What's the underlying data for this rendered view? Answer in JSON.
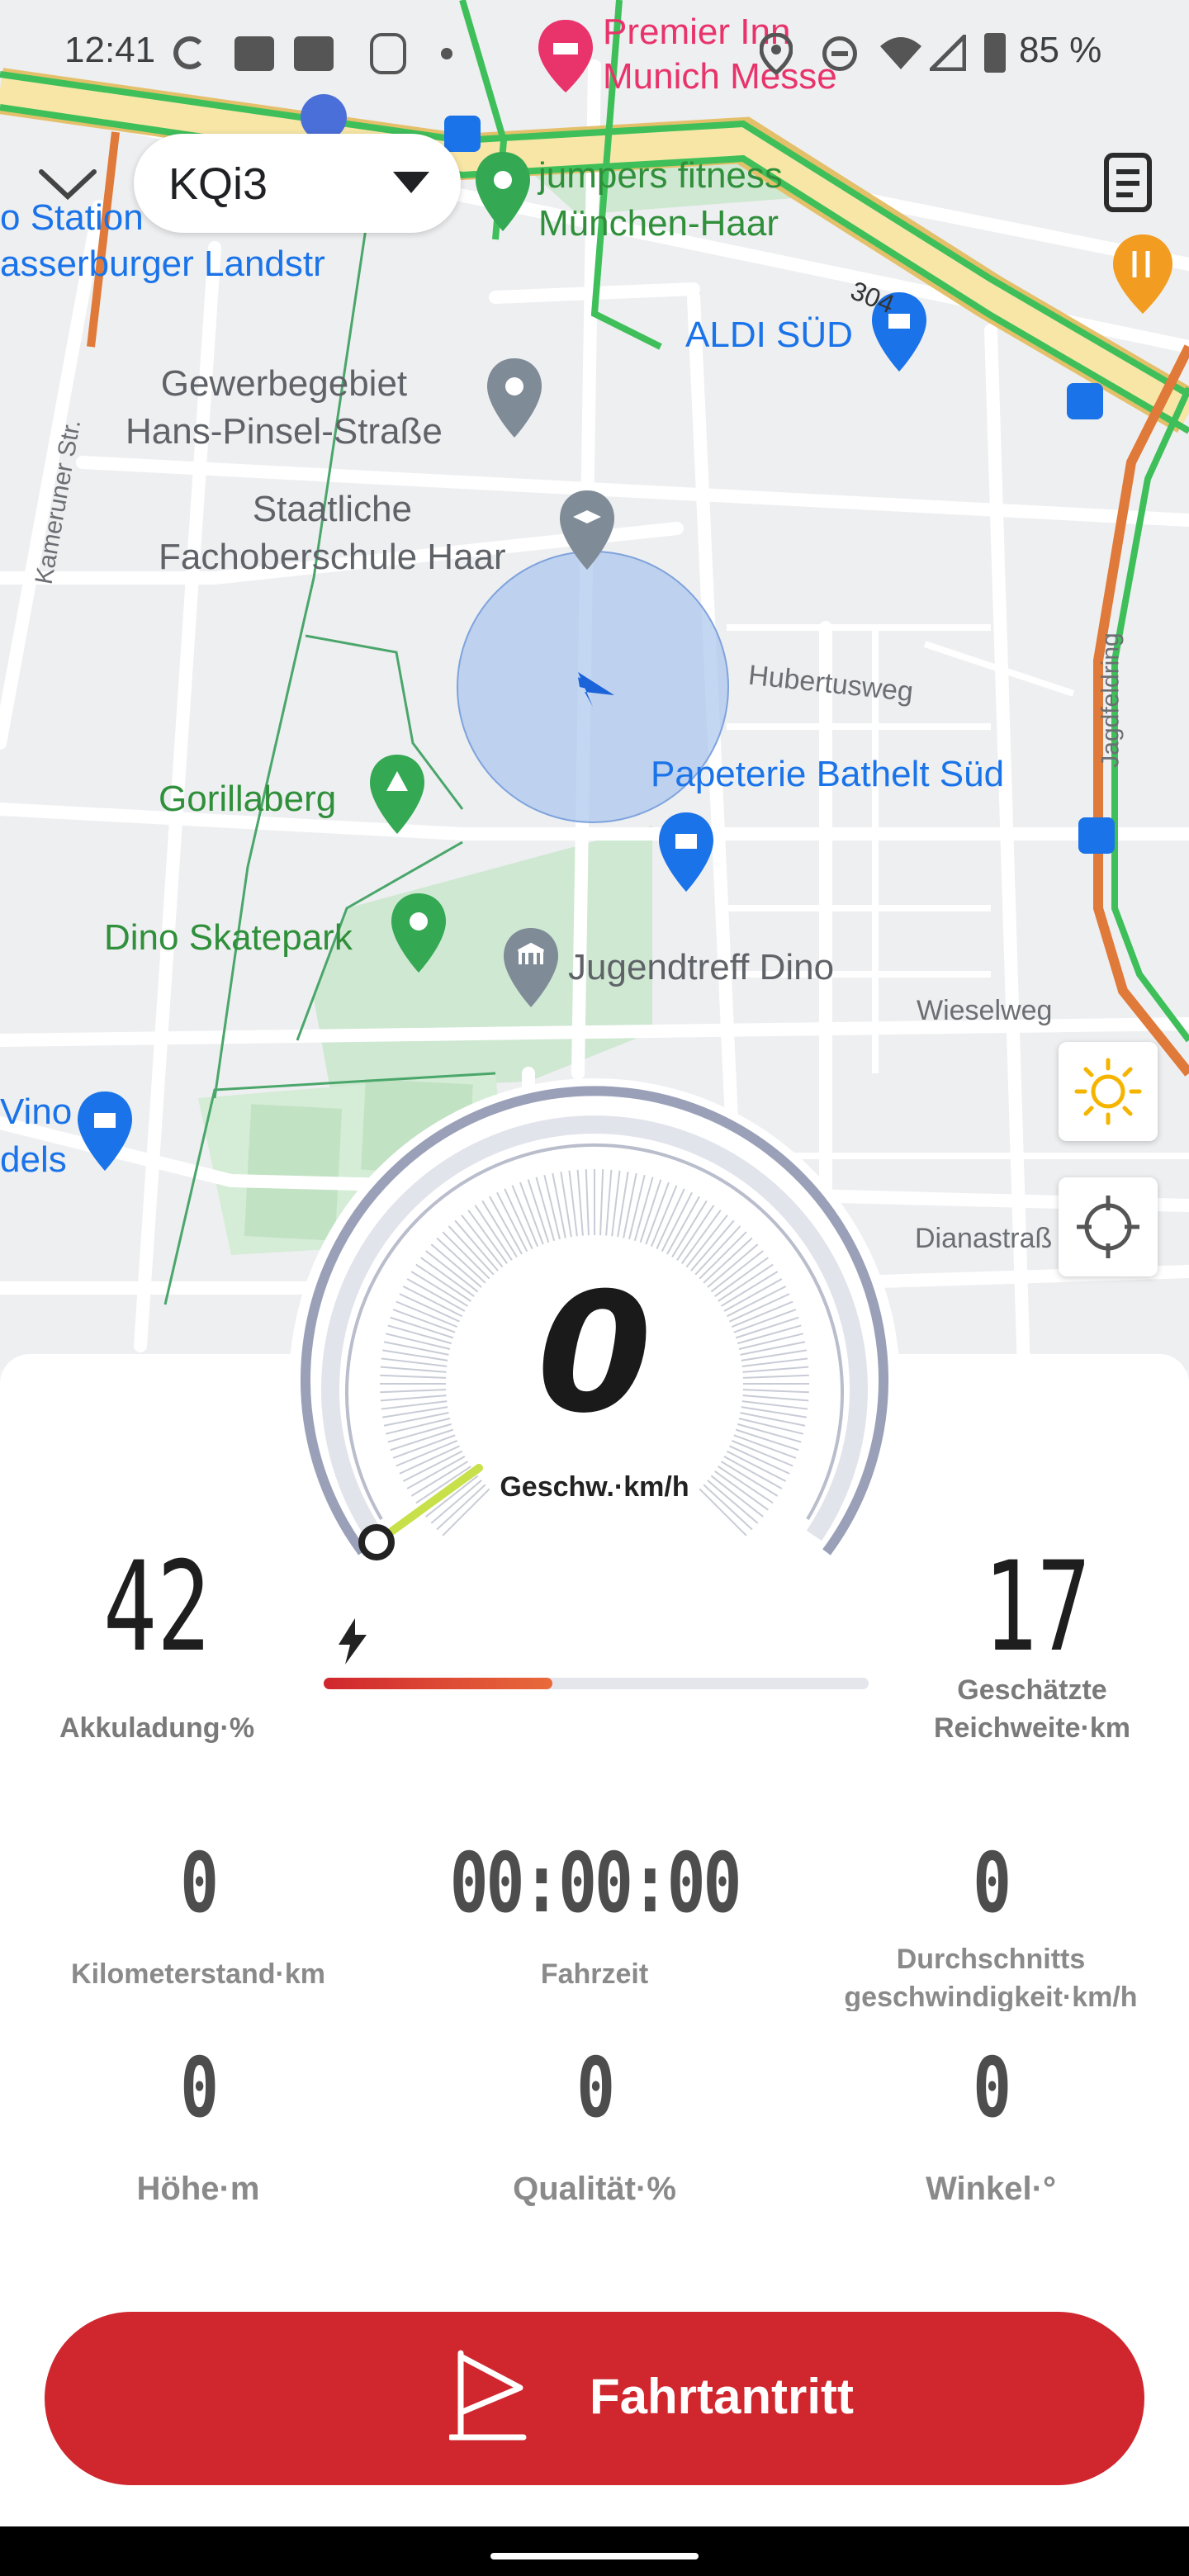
{
  "status_bar": {
    "time": "12:41",
    "battery": "85 %",
    "icons": [
      "spinner-icon",
      "teams-icon",
      "teams-icon",
      "lion-icon",
      "dot-icon",
      "location-icon",
      "dnd-icon",
      "wifi-icon",
      "signal-icon",
      "battery-icon"
    ]
  },
  "map": {
    "labels": {
      "premier_line1": "Premier Inn",
      "premier_line2": "Munich Messe",
      "jumpers_line1": "jumpers fitness",
      "jumpers_line2": "München-Haar",
      "station": "o Station",
      "wasserburger": "asserburger Landstr",
      "aldi": "ALDI SÜD",
      "road_304": "304",
      "gewerbe_line1": "Gewerbegebiet",
      "gewerbe_line2": "Hans-Pinsel-Straße",
      "kameruner": "Kameruner Str.",
      "fos_line1": "Staatliche",
      "fos_line2": "Fachoberschule Haar",
      "hubertusweg": "Hubertusweg",
      "jagdfeldring": "Jagdfeldring",
      "papeterie": "Papeterie Bathelt Süd",
      "gorillaberg": "Gorillaberg",
      "dino_skatepark": "Dino Skatepark",
      "jugendtreff": "Jugendtreff Dino",
      "wieselweg": "Wieselweg",
      "vino_line1": "Vino",
      "vino_line2": "dels",
      "dianastrasse": "Dianastraß"
    }
  },
  "header": {
    "collapse_icon": "chevron-down-icon",
    "device_selector": "KQi3",
    "dropdown_icon": "caret-down-icon",
    "menu_icon": "document-list-icon"
  },
  "controls": {
    "brightness_icon": "sun-icon",
    "locate_icon": "crosshair-icon"
  },
  "speedometer": {
    "value": "0",
    "label": "Geschw.·km/h",
    "speed_value": 0
  },
  "battery": {
    "value": "42",
    "label": "Akkuladung·%",
    "charge_fraction": 0.42,
    "icon": "lightning-icon"
  },
  "range": {
    "value": "17",
    "label_line1": "Geschätzte",
    "label_line2": "Reichweite·km"
  },
  "stats": [
    {
      "value": "0",
      "label": "Kilometerstand·km"
    },
    {
      "value": "00:00:00",
      "label": "Fahrzeit"
    },
    {
      "value": "0",
      "label_line1": "Durchschnitts",
      "label_line2": "geschwindigkeit·km/h"
    },
    {
      "value": "0",
      "label": "Höhe·m"
    },
    {
      "value": "0",
      "label": "Qualität·%"
    },
    {
      "value": "0",
      "label": "Winkel·°"
    }
  ],
  "start_button": {
    "label": "Fahrtantritt",
    "icon": "flag-icon"
  },
  "colors": {
    "primary_red": "#d0262e",
    "gauge_ring": "#9aa0b8",
    "charge_bar": "#d23a2a",
    "needle": "#c8e04a"
  }
}
